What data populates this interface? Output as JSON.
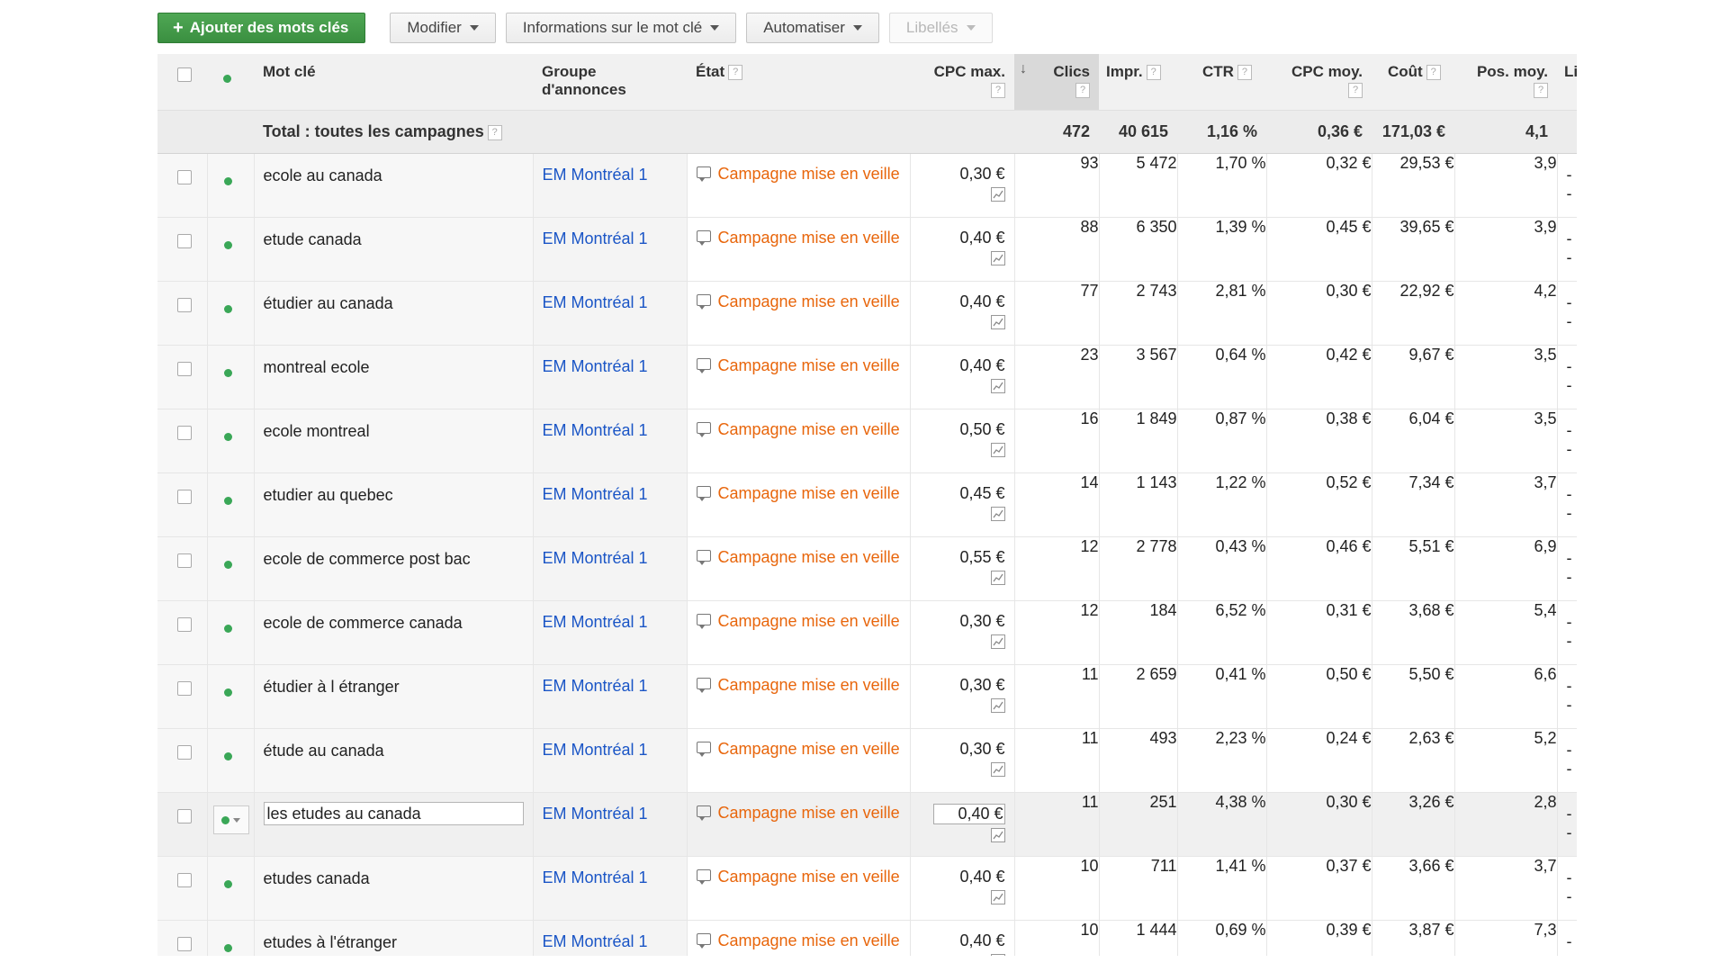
{
  "toolbar": {
    "add_label": "Ajouter des mots clés",
    "modify_label": "Modifier",
    "info_label": "Informations sur le mot clé",
    "automate_label": "Automatiser",
    "labels_label": "Libellés"
  },
  "table": {
    "headers": {
      "keyword": "Mot clé",
      "ad_group_l1": "Groupe",
      "ad_group_l2": "d'annonces",
      "state": "État",
      "max_cpc": "CPC max.",
      "clicks": "Clics",
      "impr": "Impr.",
      "ctr": "CTR",
      "avg_cpc": "CPC moy.",
      "cost": "Coût",
      "avg_pos": "Pos. moy.",
      "extra": "Li"
    },
    "help_glyph": "?",
    "sort_glyph": "↓",
    "total": {
      "label": "Total : toutes les campagnes",
      "clicks": "472",
      "impr": "40 615",
      "ctr": "1,16 %",
      "avg_cpc": "0,36 €",
      "cost": "171,03 €",
      "avg_pos": "4,1"
    },
    "rows": [
      {
        "keyword": "ecole au canada",
        "group": "EM Montréal 1",
        "state": "Campagne mise en veille",
        "max_cpc": "0,30 €",
        "clicks": "93",
        "impr": "5 472",
        "ctr": "1,70 %",
        "avg_cpc": "0,32 €",
        "cost": "29,53 €",
        "avg_pos": "3,9",
        "extra": "--"
      },
      {
        "keyword": "etude canada",
        "group": "EM Montréal 1",
        "state": "Campagne mise en veille",
        "max_cpc": "0,40 €",
        "clicks": "88",
        "impr": "6 350",
        "ctr": "1,39 %",
        "avg_cpc": "0,45 €",
        "cost": "39,65 €",
        "avg_pos": "3,9",
        "extra": "--"
      },
      {
        "keyword": "étudier au canada",
        "group": "EM Montréal 1",
        "state": "Campagne mise en veille",
        "max_cpc": "0,40 €",
        "clicks": "77",
        "impr": "2 743",
        "ctr": "2,81 %",
        "avg_cpc": "0,30 €",
        "cost": "22,92 €",
        "avg_pos": "4,2",
        "extra": "--"
      },
      {
        "keyword": "montreal ecole",
        "group": "EM Montréal 1",
        "state": "Campagne mise en veille",
        "max_cpc": "0,40 €",
        "clicks": "23",
        "impr": "3 567",
        "ctr": "0,64 %",
        "avg_cpc": "0,42 €",
        "cost": "9,67 €",
        "avg_pos": "3,5",
        "extra": "--"
      },
      {
        "keyword": "ecole montreal",
        "group": "EM Montréal 1",
        "state": "Campagne mise en veille",
        "max_cpc": "0,50 €",
        "clicks": "16",
        "impr": "1 849",
        "ctr": "0,87 %",
        "avg_cpc": "0,38 €",
        "cost": "6,04 €",
        "avg_pos": "3,5",
        "extra": "--"
      },
      {
        "keyword": "etudier au quebec",
        "group": "EM Montréal 1",
        "state": "Campagne mise en veille",
        "max_cpc": "0,45 €",
        "clicks": "14",
        "impr": "1 143",
        "ctr": "1,22 %",
        "avg_cpc": "0,52 €",
        "cost": "7,34 €",
        "avg_pos": "3,7",
        "extra": "--"
      },
      {
        "keyword": "ecole de commerce post bac",
        "group": "EM Montréal 1",
        "state": "Campagne mise en veille",
        "max_cpc": "0,55 €",
        "clicks": "12",
        "impr": "2 778",
        "ctr": "0,43 %",
        "avg_cpc": "0,46 €",
        "cost": "5,51 €",
        "avg_pos": "6,9",
        "extra": "--"
      },
      {
        "keyword": "ecole de commerce canada",
        "group": "EM Montréal 1",
        "state": "Campagne mise en veille",
        "max_cpc": "0,30 €",
        "clicks": "12",
        "impr": "184",
        "ctr": "6,52 %",
        "avg_cpc": "0,31 €",
        "cost": "3,68 €",
        "avg_pos": "5,4",
        "extra": "--"
      },
      {
        "keyword": "étudier à l étranger",
        "group": "EM Montréal 1",
        "state": "Campagne mise en veille",
        "max_cpc": "0,30 €",
        "clicks": "11",
        "impr": "2 659",
        "ctr": "0,41 %",
        "avg_cpc": "0,50 €",
        "cost": "5,50 €",
        "avg_pos": "6,6",
        "extra": "--"
      },
      {
        "keyword": "étude au canada",
        "group": "EM Montréal 1",
        "state": "Campagne mise en veille",
        "max_cpc": "0,30 €",
        "clicks": "11",
        "impr": "493",
        "ctr": "2,23 %",
        "avg_cpc": "0,24 €",
        "cost": "2,63 €",
        "avg_pos": "5,2",
        "extra": "--"
      },
      {
        "keyword": "les etudes au canada",
        "group": "EM Montréal 1",
        "state": "Campagne mise en veille",
        "max_cpc": "0,40 €",
        "clicks": "11",
        "impr": "251",
        "ctr": "4,38 %",
        "avg_cpc": "0,30 €",
        "cost": "3,26 €",
        "avg_pos": "2,8",
        "extra": "--",
        "editing": true
      },
      {
        "keyword": "etudes canada",
        "group": "EM Montréal 1",
        "state": "Campagne mise en veille",
        "max_cpc": "0,40 €",
        "clicks": "10",
        "impr": "711",
        "ctr": "1,41 %",
        "avg_cpc": "0,37 €",
        "cost": "3,66 €",
        "avg_pos": "3,7",
        "extra": "--"
      },
      {
        "keyword": "etudes à l'étranger",
        "group": "EM Montréal 1",
        "state": "Campagne mise en veille",
        "max_cpc": "0,40 €",
        "clicks": "10",
        "impr": "1 444",
        "ctr": "0,69 %",
        "avg_cpc": "0,39 €",
        "cost": "3,87 €",
        "avg_pos": "7,3",
        "extra": "--"
      }
    ]
  },
  "colors": {
    "primary_button": "#3d9443",
    "status_enabled": "#3aa757",
    "link_blue": "#1a55c6",
    "state_orange": "#e8660c"
  },
  "icons": {
    "status": "green-dot-icon",
    "state": "speech-bubble-icon",
    "bid": "line-chart-icon",
    "add": "plus-icon",
    "dropdown": "caret-down-icon"
  }
}
